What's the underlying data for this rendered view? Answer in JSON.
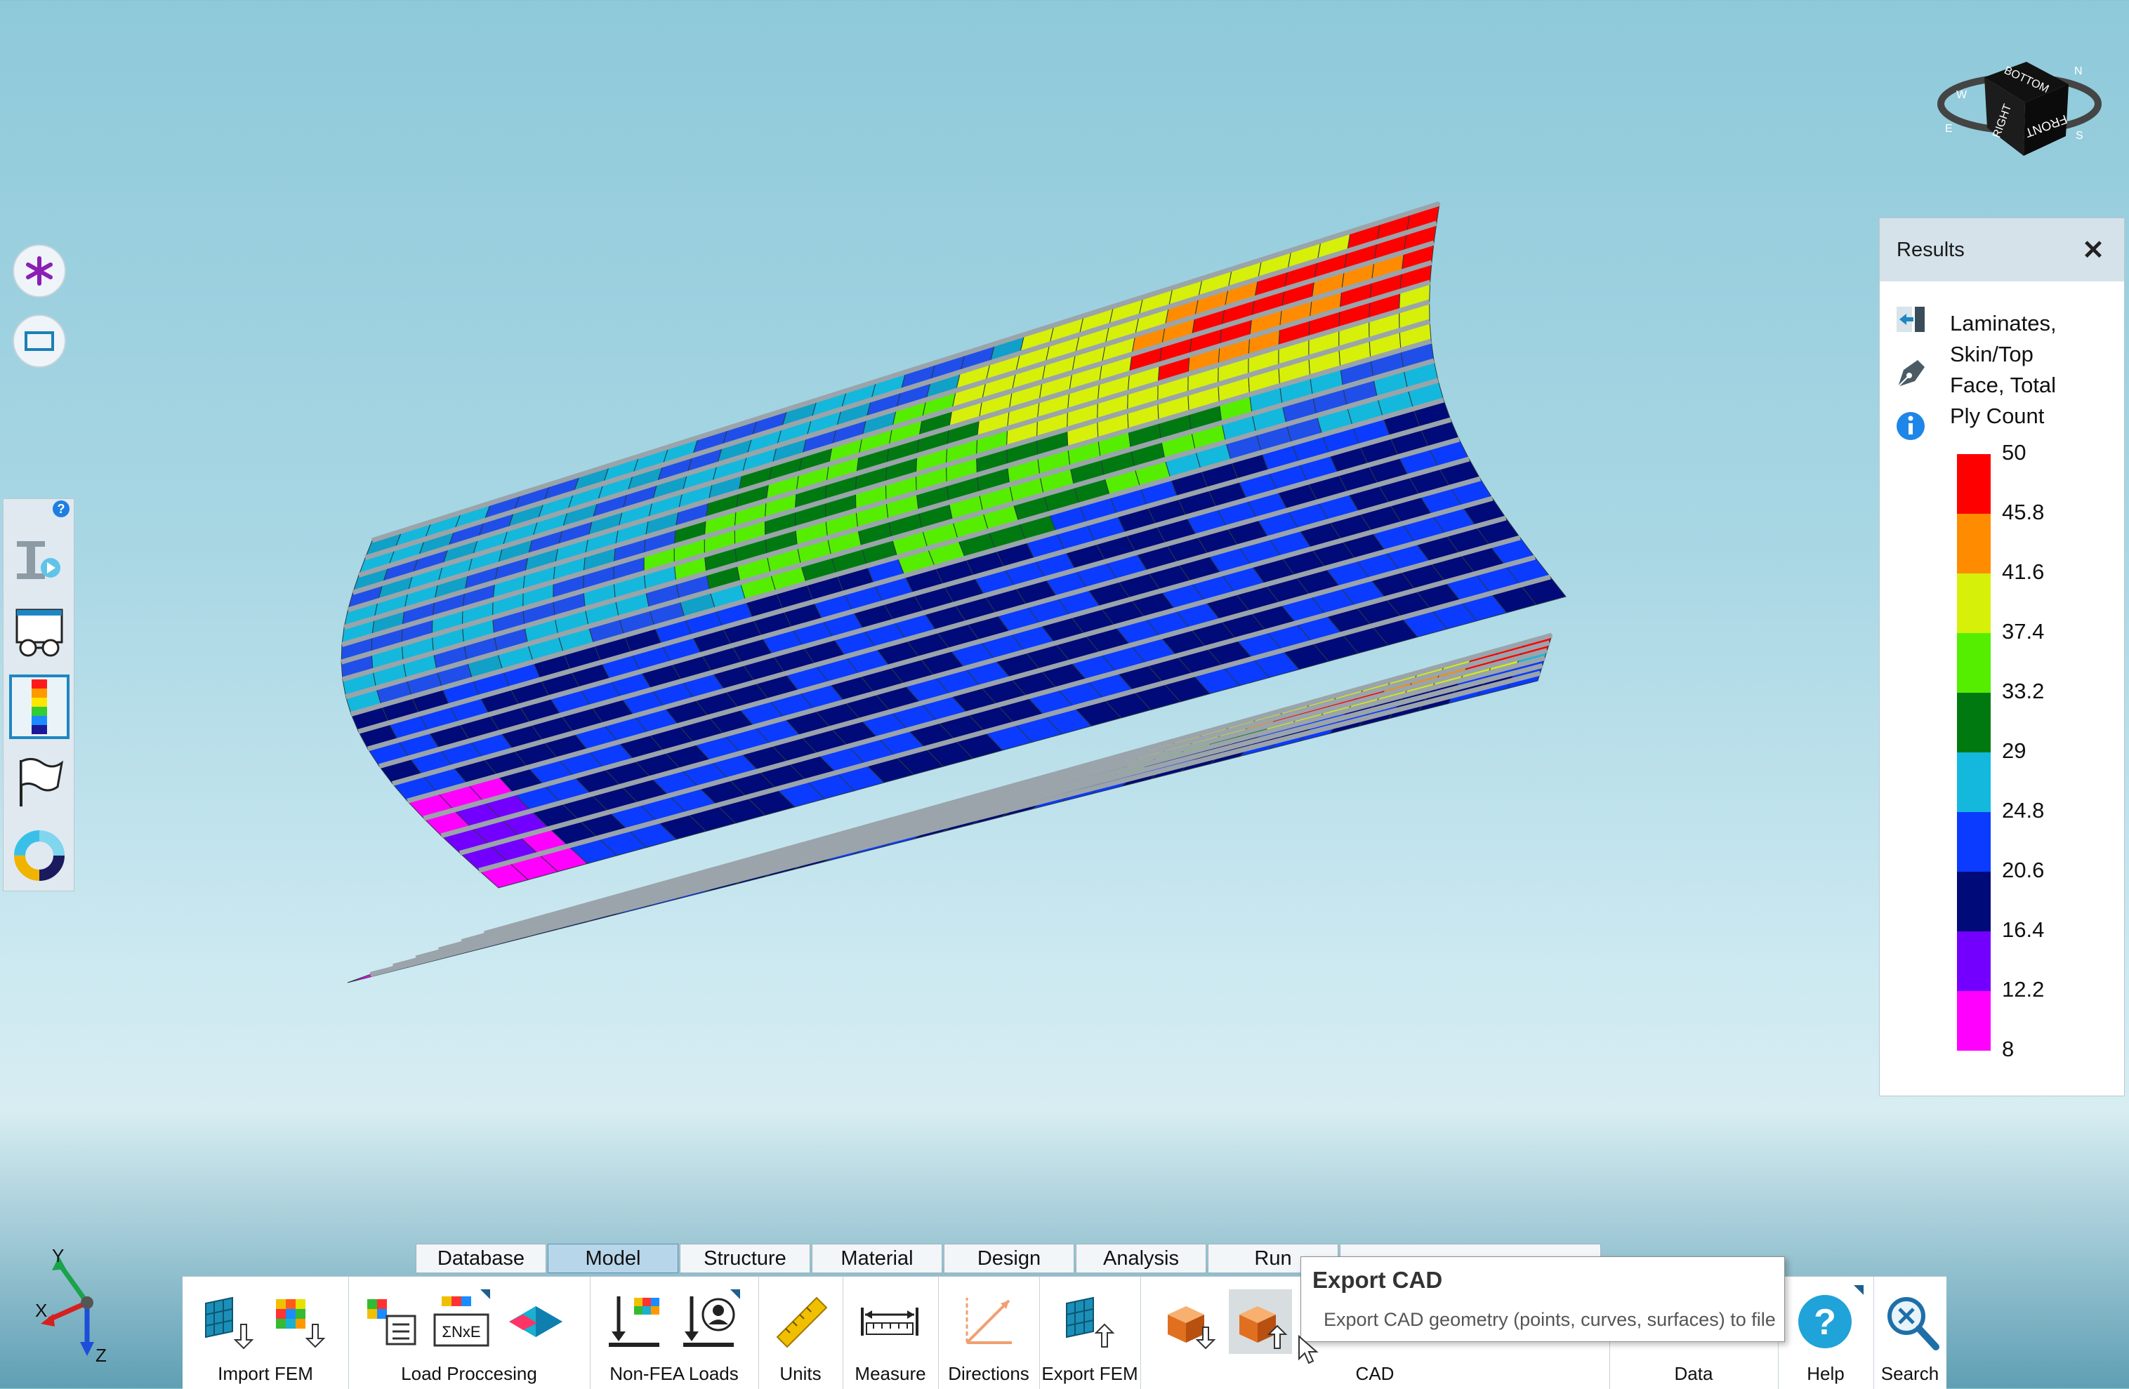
{
  "results_panel": {
    "title": "Results",
    "description_lines": [
      "Laminates,",
      "Skin/Top",
      "Face, Total",
      "Ply Count"
    ],
    "legend": {
      "labels": [
        "50",
        "45.8",
        "41.6",
        "37.4",
        "33.2",
        "29",
        "24.8",
        "20.6",
        "16.4",
        "12.2",
        "8"
      ],
      "colors": [
        "#ff0000",
        "#ff8c00",
        "#d6f00a",
        "#55ee00",
        "#007a10",
        "#14b8dc",
        "#0a3bff",
        "#000a78",
        "#7300ff",
        "#ff00ff"
      ]
    }
  },
  "view_cube": {
    "face_labels": [
      "FRONT",
      "RIGHT",
      "BOTTOM"
    ],
    "compass_letters": [
      "W",
      "N",
      "E",
      "S"
    ]
  },
  "axis_triad": {
    "x": "X",
    "y": "Y",
    "z": "Z"
  },
  "side_palette": {
    "help_badge": "?"
  },
  "ribbon": {
    "tabs": [
      {
        "label": "Database",
        "selected": false
      },
      {
        "label": "Model",
        "selected": true
      },
      {
        "label": "Structure",
        "selected": false
      },
      {
        "label": "Material",
        "selected": false
      },
      {
        "label": "Design",
        "selected": false
      },
      {
        "label": "Analysis",
        "selected": false
      },
      {
        "label": "Run",
        "selected": false
      }
    ],
    "groups": {
      "import_fem": "Import FEM",
      "load_processing": "Load Proccesing",
      "non_fea_loads": "Non-FEA Loads",
      "units": "Units",
      "measure": "Measure",
      "directions": "Directions",
      "export_fem": "Export FEM",
      "cad": "CAD",
      "data": "Data",
      "help": "Help",
      "search": "Search"
    },
    "load_processing_symbol": "ΣNxE"
  },
  "tooltip": {
    "title": "Export CAD",
    "body": "Export CAD geometry (points, curves, surfaces) to file"
  },
  "colors": {
    "accent": "#1e86c2",
    "background_top": "#8ec9da"
  }
}
